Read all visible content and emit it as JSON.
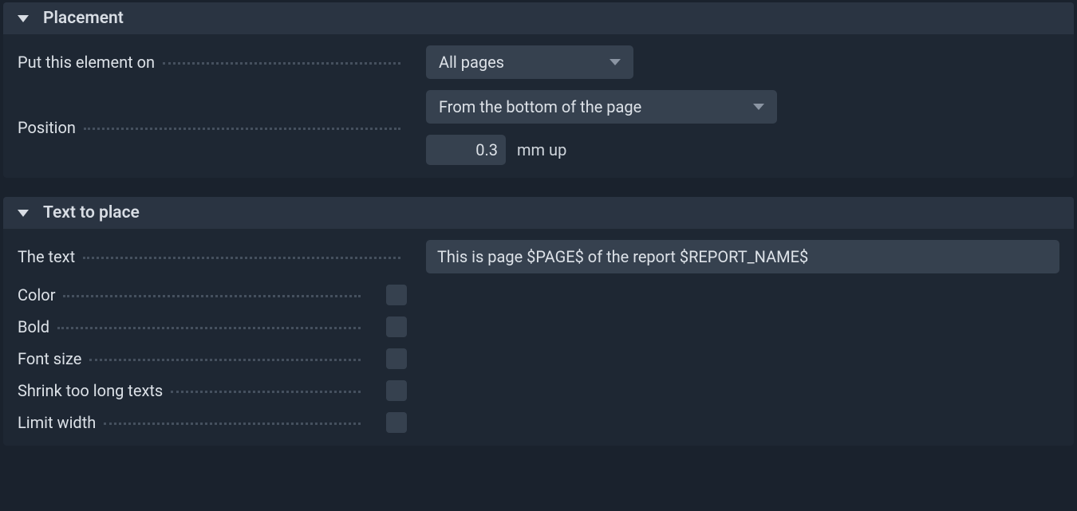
{
  "sections": {
    "placement": {
      "title": "Placement",
      "put_on": {
        "label": "Put this element on",
        "value": "All pages"
      },
      "position": {
        "label": "Position",
        "value": "From the bottom of the page",
        "offset_value": "0.3",
        "offset_unit": "mm up"
      }
    },
    "text_to_place": {
      "title": "Text to place",
      "the_text": {
        "label": "The text",
        "value": "This is page $PAGE$ of the report $REPORT_NAME$"
      },
      "color": {
        "label": "Color",
        "checked": false
      },
      "bold": {
        "label": "Bold",
        "checked": false
      },
      "font_size": {
        "label": "Font size",
        "checked": false
      },
      "shrink": {
        "label": "Shrink too long texts",
        "checked": false
      },
      "limit_width": {
        "label": "Limit width",
        "checked": false
      }
    }
  }
}
